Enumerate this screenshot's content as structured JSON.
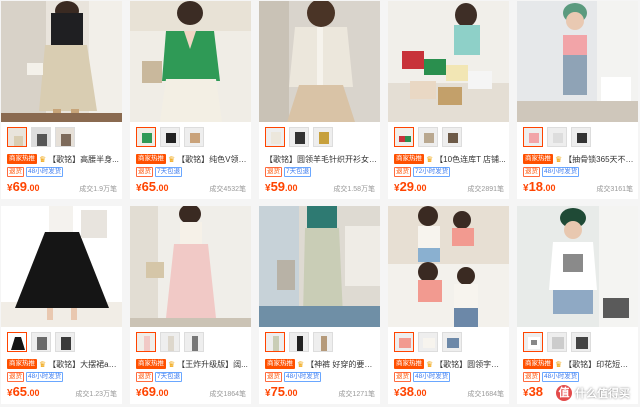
{
  "products": [
    {
      "hot": "商家热推",
      "title": "【歌铭】高腰半身...",
      "badge1": "退货",
      "badge2": "48小时发货",
      "currency": "¥",
      "price_int": "69",
      "price_dec": ".00",
      "sold": "成交1.9万笔"
    },
    {
      "hot": "商家热推",
      "title": "【歌铭】纯色V领针织...",
      "badge1": "退货",
      "badge2": "7天包退",
      "currency": "¥",
      "price_int": "65",
      "price_dec": ".00",
      "sold": "成交4532笔"
    },
    {
      "hot": "",
      "title": "【歌铭】圆领羊毛针织开衫女装...",
      "badge1": "退货",
      "badge2": "7天包退",
      "currency": "¥",
      "price_int": "59",
      "price_dec": ".00",
      "sold": "成交1.58万笔"
    },
    {
      "hot": "商家热推",
      "title": "【10色连库T 店铺...",
      "badge1": "退货",
      "badge2": "72小时发货",
      "currency": "¥",
      "price_int": "29",
      "price_dec": ".00",
      "sold": "成交2891笔"
    },
    {
      "hot": "商家热推",
      "title": "【抽骨锁365天不离身...",
      "badge1": "退货",
      "badge2": "48小时发货",
      "currency": "¥",
      "price_int": "18",
      "price_dec": ".00",
      "sold": "成交3161笔"
    },
    {
      "hot": "商家热推",
      "title": "【歌铭】大摆裙a字...",
      "badge1": "退货",
      "badge2": "48小时发货",
      "currency": "¥",
      "price_int": "65",
      "price_dec": ".00",
      "sold": "成交1.23万笔"
    },
    {
      "hot": "商家热推",
      "title": "【王炸升级版】阔...",
      "badge1": "退货",
      "badge2": "7天包退",
      "currency": "¥",
      "price_int": "69",
      "price_dec": ".00",
      "sold": "成交1864笔"
    },
    {
      "hot": "商家热推",
      "title": "【神裤 好穿的要命...",
      "badge1": "退货",
      "badge2": "48小时发货",
      "currency": "¥",
      "price_int": "75",
      "price_dec": ".00",
      "sold": "成交1271笔"
    },
    {
      "hot": "商家热推",
      "title": "【歌铭】圆领字母短袖...",
      "badge1": "退货",
      "badge2": "48小时发货",
      "currency": "¥",
      "price_int": "38",
      "price_dec": ".00",
      "sold": "成交1684笔"
    },
    {
      "hot": "商家热推",
      "title": "【歌铭】印花短袖t恤2022...",
      "badge1": "退货",
      "badge2": "48小时发货",
      "currency": "¥",
      "price_int": "38",
      "price_dec": "",
      "sold": ""
    }
  ],
  "watermark": {
    "glyph": "值",
    "text": "什么值得买"
  },
  "colors": {
    "price": "#ff4400",
    "hot_badge": "#ff5000",
    "delivery_badge": "#3d7cf0"
  }
}
